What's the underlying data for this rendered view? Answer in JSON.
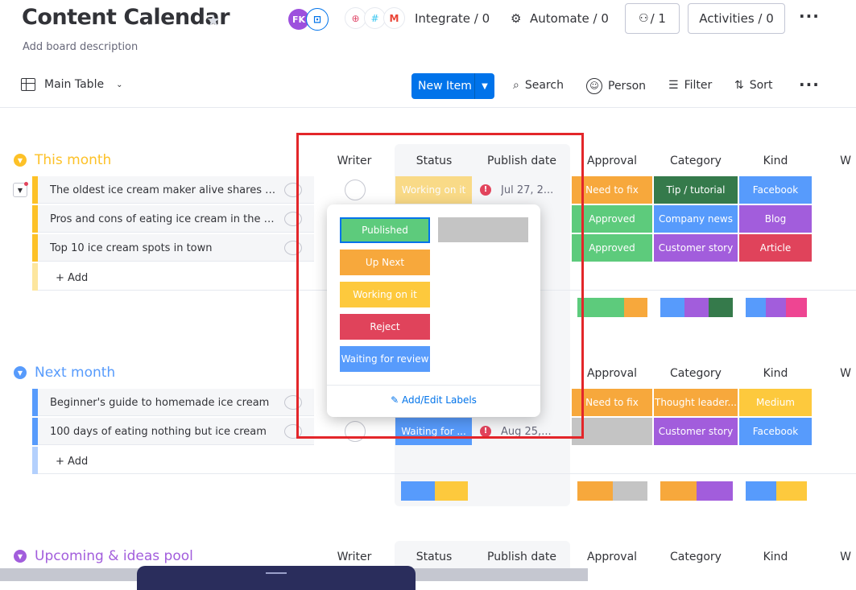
{
  "header": {
    "title": "Content Calendar",
    "description": "Add board description",
    "avatar_initials": "FK",
    "integrate": "Integrate / 0",
    "automate": "Automate / 0",
    "members": "/ 1",
    "activities": "Activities / 0"
  },
  "toolbar": {
    "view": "Main Table",
    "new_item": "New Item",
    "search": "Search",
    "person": "Person",
    "filter": "Filter",
    "sort": "Sort"
  },
  "columns": {
    "writer": "Writer",
    "status": "Status",
    "publish_date": "Publish date",
    "approval": "Approval",
    "category": "Category",
    "kind": "Kind",
    "w": "W"
  },
  "groups": [
    {
      "name": "This month",
      "color": "#fdc127",
      "add": "+ Add",
      "rows": [
        {
          "title": "The oldest ice cream maker alive shares his se...",
          "status": "Working on it",
          "date": "Jul 27, 2...",
          "approval": "Need to fix",
          "category": "Tip / tutorial",
          "kind": "Facebook"
        },
        {
          "title": "Pros and cons of eating ice cream in the winter",
          "approval": "Approved",
          "category": "Company news",
          "kind": "Blog"
        },
        {
          "title": "Top 10 ice cream spots in town",
          "approval": "Approved",
          "category": "Customer story",
          "kind": "Article"
        }
      ]
    },
    {
      "name": "Next month",
      "color": "#579bfc",
      "add": "+ Add",
      "rows": [
        {
          "title": "Beginner's guide to homemade ice cream",
          "approval": "Need to fix",
          "category": "Thought leader...",
          "kind": "Medium"
        },
        {
          "title": "100 days of eating nothing but ice cream",
          "status": "Waiting for ...",
          "date": "Aug 25,...",
          "approval": "",
          "category": "Customer story",
          "kind": "Facebook"
        }
      ]
    },
    {
      "name": "Upcoming & ideas pool",
      "color": "#a25ddc"
    }
  ],
  "status_popup": {
    "labels": [
      {
        "text": "Published",
        "color": "#5dcb7c"
      },
      {
        "text": "Up Next",
        "color": "#f7a83c"
      },
      {
        "text": "Working on it",
        "color": "#fdc93d"
      },
      {
        "text": "Reject",
        "color": "#e0435b"
      },
      {
        "text": "Waiting for review",
        "color": "#579bfc"
      }
    ],
    "edit_labels": "Add/Edit Labels"
  },
  "colors": {
    "green": "#5dcb7c",
    "orange": "#f7a83c",
    "yellow": "#fdc93d",
    "red": "#e0435b",
    "blue": "#579bfc",
    "purple": "#a25ddc",
    "darkgreen": "#357a4b",
    "pink": "#ee4592",
    "accent": "#0073ea"
  }
}
